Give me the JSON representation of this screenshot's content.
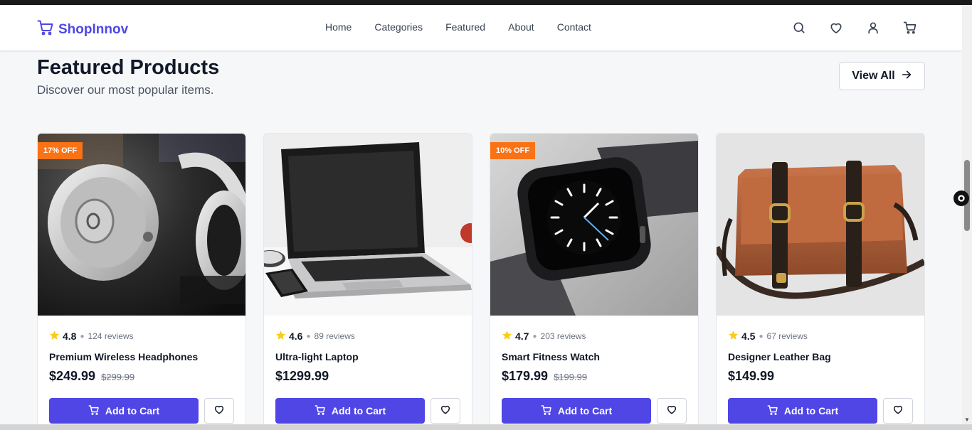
{
  "brand": {
    "name": "ShopInnov",
    "color": "#4f46e5"
  },
  "nav": {
    "links": [
      "Home",
      "Categories",
      "Featured",
      "About",
      "Contact"
    ],
    "icons": [
      "search-icon",
      "heart-icon",
      "user-icon",
      "cart-icon"
    ]
  },
  "section": {
    "title": "Featured Products",
    "subtitle": "Discover our most popular items.",
    "view_all": "View All"
  },
  "products": [
    {
      "name": "Premium Wireless Headphones",
      "rating": "4.8",
      "reviews": "124 reviews",
      "price": "$249.99",
      "old_price": "$299.99",
      "badge": "17% OFF",
      "add_label": "Add to Cart"
    },
    {
      "name": "Ultra-light Laptop",
      "rating": "4.6",
      "reviews": "89 reviews",
      "price": "$1299.99",
      "old_price": "",
      "badge": "",
      "add_label": "Add to Cart"
    },
    {
      "name": "Smart Fitness Watch",
      "rating": "4.7",
      "reviews": "203 reviews",
      "price": "$179.99",
      "old_price": "$199.99",
      "badge": "10% OFF",
      "add_label": "Add to Cart"
    },
    {
      "name": "Designer Leather Bag",
      "rating": "4.5",
      "reviews": "67 reviews",
      "price": "$149.99",
      "old_price": "",
      "badge": "",
      "add_label": "Add to Cart"
    }
  ],
  "colors": {
    "accent": "#4f46e5",
    "badge": "#f97316",
    "star": "#facc15"
  }
}
